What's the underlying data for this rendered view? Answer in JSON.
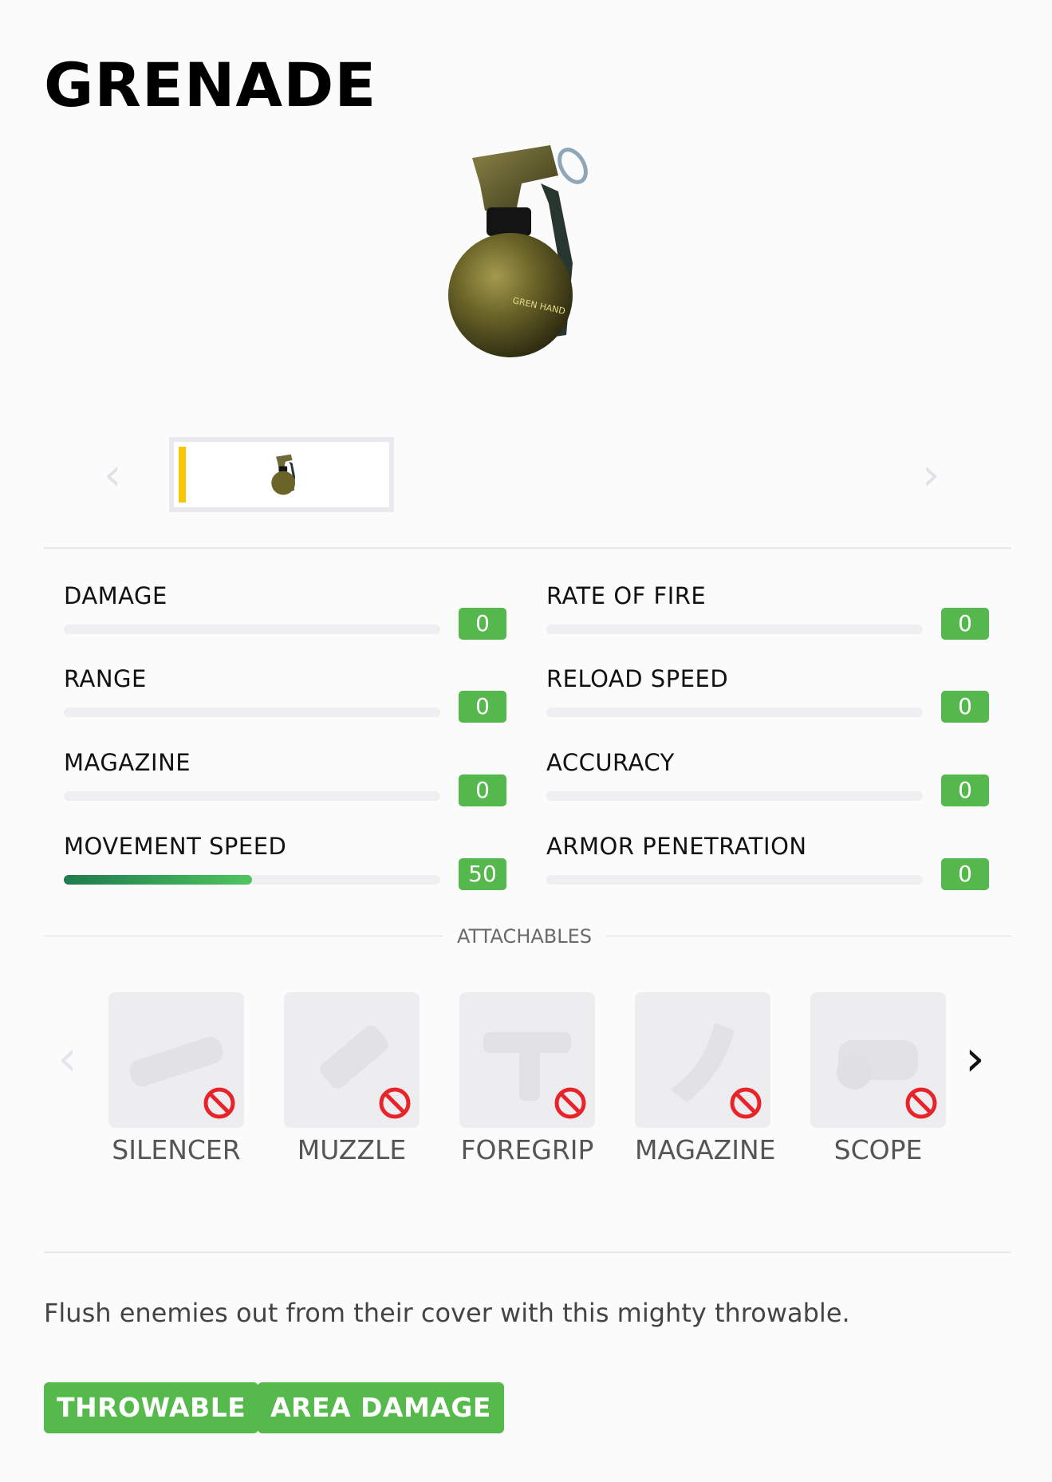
{
  "item": {
    "title": "GRENADE",
    "hero_icon": "grenade-image"
  },
  "stats": [
    {
      "label": "DAMAGE",
      "value": "0",
      "fill": 0
    },
    {
      "label": "RATE OF FIRE",
      "value": "0",
      "fill": 0
    },
    {
      "label": "RANGE",
      "value": "0",
      "fill": 0
    },
    {
      "label": "RELOAD SPEED",
      "value": "0",
      "fill": 0
    },
    {
      "label": "MAGAZINE",
      "value": "0",
      "fill": 0
    },
    {
      "label": "ACCURACY",
      "value": "0",
      "fill": 0
    },
    {
      "label": "MOVEMENT SPEED",
      "value": "50",
      "fill": 0.5
    },
    {
      "label": "ARMOR PENETRATION",
      "value": "0",
      "fill": 0
    }
  ],
  "attachables": {
    "heading": "ATTACHABLES",
    "items": [
      {
        "name": "SILENCER",
        "icon": "silencer-icon",
        "status": "unavailable"
      },
      {
        "name": "MUZZLE",
        "icon": "muzzle-icon",
        "status": "unavailable"
      },
      {
        "name": "FOREGRIP",
        "icon": "foregrip-icon",
        "status": "unavailable"
      },
      {
        "name": "MAGAZINE",
        "icon": "magazine-icon",
        "status": "unavailable"
      },
      {
        "name": "SCOPE",
        "icon": "scope-icon",
        "status": "unavailable"
      }
    ]
  },
  "description": "Flush enemies out from their cover with this mighty throwable.",
  "tags": [
    "THROWABLE",
    "AREA DAMAGE"
  ],
  "colors": {
    "badge": "#54b84d",
    "tag": "#55b94b",
    "selected_marker": "#f7c800",
    "ban": "#e8232a"
  }
}
